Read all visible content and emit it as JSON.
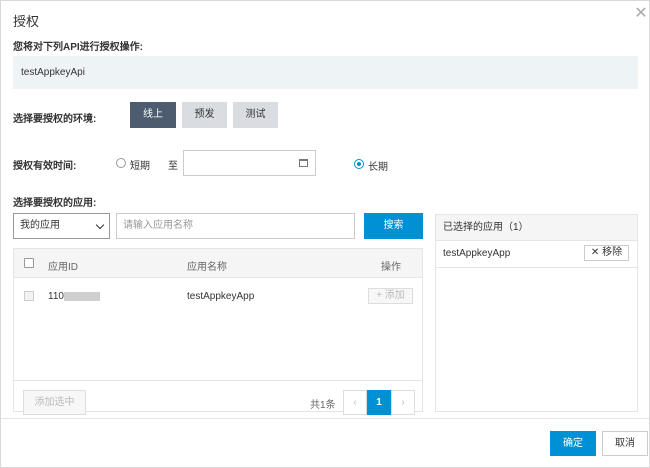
{
  "dialog": {
    "title": "授权",
    "close_icon": "close-icon"
  },
  "api_section": {
    "label": "您将对下列API进行授权操作:",
    "api_name": "testAppkeyApi"
  },
  "env_section": {
    "label": "选择要授权的环境:",
    "options": [
      {
        "label": "线上",
        "selected": true
      },
      {
        "label": "预发",
        "selected": false
      },
      {
        "label": "测试",
        "selected": false
      }
    ]
  },
  "time_section": {
    "label": "授权有效时间:",
    "short_label": "短期",
    "to_label": "至",
    "date_value": "",
    "long_label": "长期",
    "selected": "长期",
    "calendar_icon": "calendar-icon"
  },
  "app_section": {
    "label": "选择要授权的应用:",
    "select_value": "我的应用",
    "search_placeholder": "请输入应用名称",
    "search_button": "搜索"
  },
  "table": {
    "columns": [
      "应用ID",
      "应用名称",
      "操作"
    ],
    "rows": [
      {
        "app_id": "110",
        "app_name": "testAppkeyApp",
        "action": "+ 添加"
      }
    ],
    "add_selected": "添加选中",
    "total": "共1条",
    "pager": {
      "prev": "‹",
      "page": "1",
      "next": "›"
    }
  },
  "selected_panel": {
    "title": "已选择的应用（1）",
    "items": [
      {
        "name": "testAppkeyApp",
        "remove_label": "✕ 移除"
      }
    ]
  },
  "footer": {
    "ok": "确定",
    "cancel": "取消"
  },
  "colors": {
    "primary": "#0091d5",
    "env_active": "#4d5c6f"
  }
}
